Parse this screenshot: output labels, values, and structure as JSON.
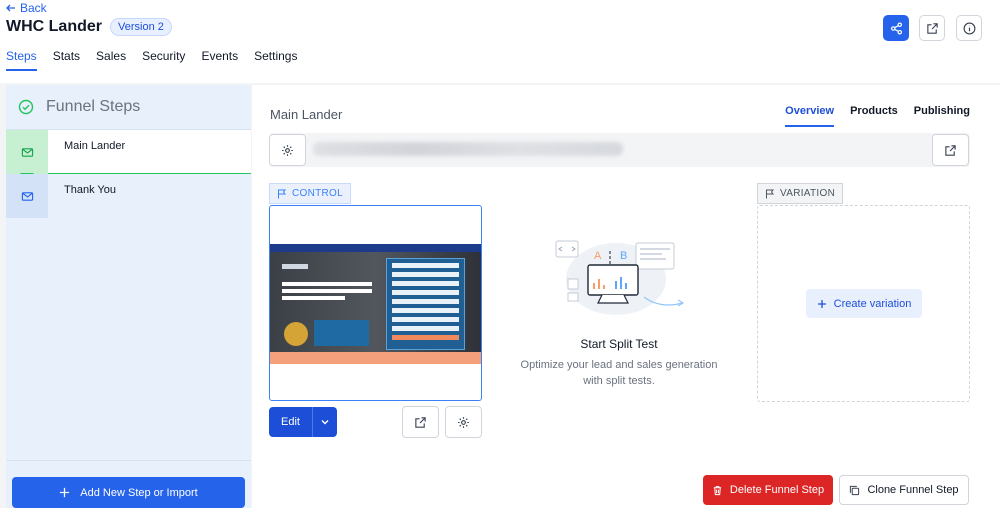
{
  "header": {
    "back_label": "Back",
    "title": "WHC Lander",
    "version_badge": "Version 2"
  },
  "tabs": [
    "Steps",
    "Stats",
    "Sales",
    "Security",
    "Events",
    "Settings"
  ],
  "sidebar": {
    "title": "Funnel Steps",
    "items": [
      {
        "label": "Main Lander",
        "active": true
      },
      {
        "label": "Thank You",
        "active": false
      }
    ],
    "add_button_label": "Add New Step or Import"
  },
  "main": {
    "step_name": "Main Lander",
    "tabs": [
      "Overview",
      "Products",
      "Publishing"
    ],
    "control_tag": "CONTROL",
    "variation_tag": "VARIATION",
    "edit_label": "Edit",
    "split_test": {
      "title": "Start Split Test",
      "subtitle": "Optimize your lead and sales generation with split tests."
    },
    "create_variation_label": "Create variation",
    "delete_label": "Delete Funnel Step",
    "clone_label": "Clone Funnel Step"
  },
  "colors": {
    "primary": "#2563eb",
    "success": "#22c55e",
    "danger": "#dc2626"
  },
  "icons": [
    "share-icon",
    "external-link-icon",
    "info-icon",
    "gear-icon",
    "flag-icon",
    "mail-icon",
    "check-circle-icon",
    "plus-icon",
    "trash-icon",
    "copy-icon",
    "chevron-down-icon"
  ]
}
